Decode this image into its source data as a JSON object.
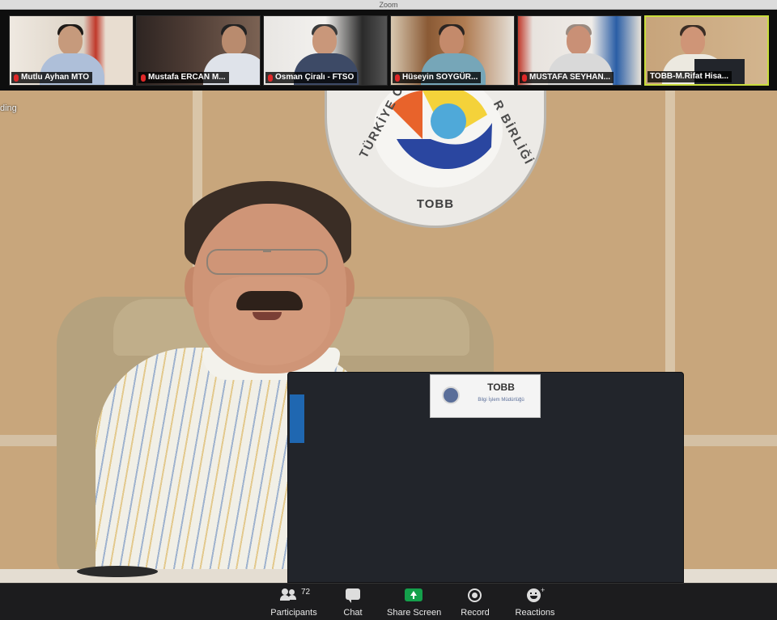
{
  "window": {
    "title": "Zoom"
  },
  "gallery": {
    "tiles": [
      {
        "name": "Mutlu Ayhan MTO",
        "muted": true
      },
      {
        "name": "Mustafa ERCAN M...",
        "muted": true
      },
      {
        "name": "Osman Çiralı - FTSO",
        "muted": true
      },
      {
        "name": "Hüseyin SOYGÜR...",
        "muted": true
      },
      {
        "name": "MUSTAFA SEYHAN...",
        "muted": true
      },
      {
        "name": "TOBB-M.Rifat Hisa...",
        "muted": false,
        "active": true
      }
    ]
  },
  "main_video": {
    "recording_label": "ding",
    "wall_logo": {
      "left_arc_text": "TÜRKİYE O",
      "right_arc_text": "R BİRLİĞİ",
      "bottom_text": "TOBB"
    },
    "laptop_sticker": {
      "title": "TOBB",
      "subtitle": "Bilgi İşlem Müdürlüğü"
    }
  },
  "toolbar": {
    "participants_label": "Participants",
    "participants_count": "72",
    "chat_label": "Chat",
    "share_screen_label": "Share Screen",
    "record_label": "Record",
    "reactions_label": "Reactions"
  },
  "colors": {
    "active_speaker_border": "#c9dc3c",
    "share_screen_green": "#14a04b",
    "muted_red": "#e02828",
    "toolbar_bg": "#1c1c1e"
  }
}
